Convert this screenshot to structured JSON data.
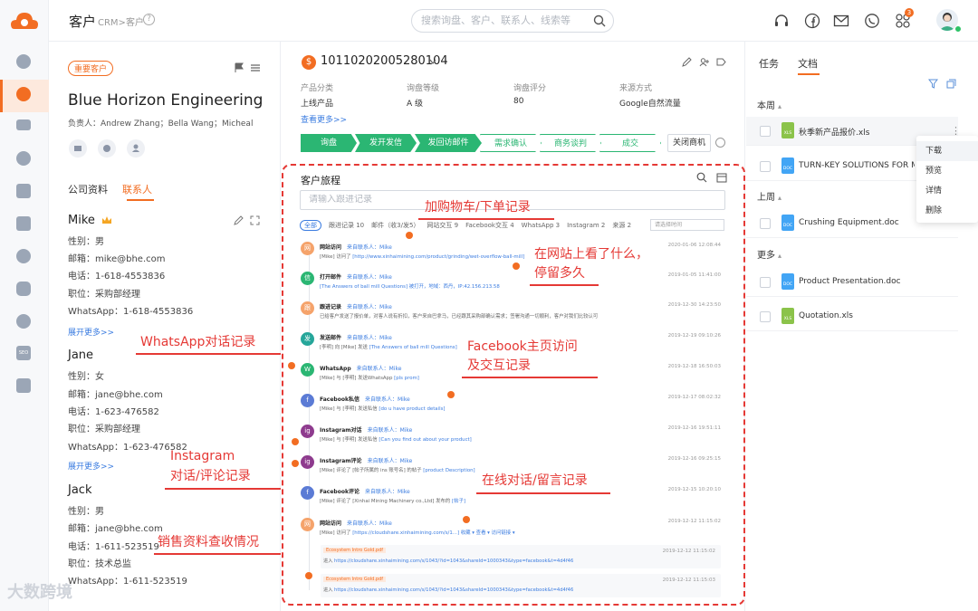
{
  "header": {
    "title": "客户",
    "crumb": "CRM>客户",
    "help": "?",
    "search_placeholder": "搜索询盘、客户、联系人、线索等",
    "notif_count": "3"
  },
  "rail": {
    "icons": [
      "dashboard-icon",
      "customer-icon",
      "mail-icon",
      "whatsapp-icon",
      "document-icon",
      "chat-icon",
      "facebook-icon",
      "instagram-icon",
      "google-icon",
      "seo-icon",
      "analytics-icon"
    ],
    "seo_label": "SEO"
  },
  "customer": {
    "tag": "重要客户",
    "name": "Blue Horizon Engineering",
    "owners": "负责人：Andrew Zhang；Bella Wang；Micheal",
    "tabs": [
      "公司资料",
      "联系人"
    ]
  },
  "contacts": [
    {
      "name": "Mike",
      "gender": "性别：男",
      "email": "邮箱：mike@bhe.com",
      "phone": "电话：1-618-4553836",
      "title": "职位：采购部经理",
      "whatsapp": "WhatsApp：1-618-4553836",
      "more": "展开更多>>"
    },
    {
      "name": "Jane",
      "gender": "性别：女",
      "email": "邮箱：jane@bhe.com",
      "phone": "电话：1-623-476582",
      "title": "职位：采购部经理",
      "whatsapp": "WhatsApp：1-623-476582",
      "more": "展开更多>>"
    },
    {
      "name": "Jack",
      "gender": "性别：男",
      "email": "邮箱：jane@bhe.com",
      "phone": "电话：1-611-523519",
      "title": "职位：技术总监",
      "whatsapp": "WhatsApp：1-611-523519"
    }
  ],
  "opportunity": {
    "currency_icon": "$",
    "number": "10110202005280104",
    "fields": [
      {
        "label": "产品分类",
        "value": "上线产品"
      },
      {
        "label": "询盘等级",
        "value": "A 级"
      },
      {
        "label": "询盘评分",
        "value": "80"
      },
      {
        "label": "来源方式",
        "value": "Google自然流量"
      }
    ],
    "see_more": "查看更多>>",
    "stages": [
      "询盘",
      "发开发信",
      "发回访邮件",
      "需求确认",
      "商务谈判",
      "成交"
    ],
    "stages_done": 3,
    "close_button": "关闭商机"
  },
  "journey": {
    "title": "客户旅程",
    "input_placeholder": "请输入跟进记录",
    "filters": {
      "all": "全部",
      "items": [
        "跟进记录 10",
        "邮件（收3/发5）",
        "网站交互 9",
        "Facebook交互 4",
        "WhatsApp 3",
        "Instagram 2",
        "来源 2"
      ]
    },
    "time_placeholder": "请选择时间",
    "events": [
      {
        "icon": "网",
        "color": "#f5a36b",
        "title": "网站访问",
        "source": "来自联系人：Mike",
        "desc": "[Mike] 访问了 ",
        "link": "[http://www.xinhaimining.com/product/grinding/wet-overflow-ball-mill]",
        "time": "2020-01-06 12:08:44"
      },
      {
        "icon": "信",
        "color": "#2bb673",
        "title": "打开邮件",
        "source": "来自联系人：Mike",
        "desc": "",
        "link": "[The Answers of ball mill Questions] 被打开，地域：西丹，IP:42.156.213.58",
        "time": "2019-01-05 11:41:00"
      },
      {
        "icon": "跟",
        "color": "#f5a36b",
        "title": "跟进记录",
        "source": "来自联系人：Mike",
        "desc": "已给客户发送了报价单，对客人说有折扣，客户来自巴拿马，已经跟其采购部确认需求；签署沟通一切顺利，客户对我们比较认可",
        "link": "",
        "time": "2019-12-30 14:23:50"
      },
      {
        "icon": "发",
        "color": "#26a69a",
        "title": "发送邮件",
        "source": "来自联系人：Mike",
        "desc": "[李明] 向 [Mike] 发送 ",
        "link": "[The Answers of ball mill Questions]",
        "time": "2019-12-19 09:10:26"
      },
      {
        "icon": "W",
        "color": "#2bb673",
        "title": "WhatsApp",
        "source": "来自联系人：Mike",
        "desc": "[Mike] 与 [李明] 发送WhatsApp ",
        "link": "[pls prom]",
        "time": "2019-12-18 16:50:03"
      },
      {
        "icon": "f",
        "color": "#5b7bd5",
        "title": "Facebook私信",
        "source": "来自联系人：Mike",
        "desc": "[Mike] 与 [李明] 发送私信 ",
        "link": "[do u have product details]",
        "time": "2019-12-17 08:02:32"
      },
      {
        "icon": "ig",
        "color": "#8e3b8e",
        "title": "Instagram对话",
        "source": "来自联系人：Mike",
        "desc": "[Mike] 与 [李明] 发送私信 ",
        "link": "[Can you find out about your product]",
        "time": "2019-12-16 19:51:11"
      },
      {
        "icon": "ig",
        "color": "#8e3b8e",
        "title": "Instagram评论",
        "source": "来自联系人：Mike",
        "desc": "[Mike] 评论了 [帖子所属的 ins 账号名] 的帖子 ",
        "link": "[product Description]",
        "time": "2019-12-16 09:25:15"
      },
      {
        "icon": "f",
        "color": "#5b7bd5",
        "title": "Facebook评论",
        "source": "来自联系人：Mike",
        "desc": "[Mike] 评论了 [Xinhai Mining Machinery co.,Ltd] 发布的 ",
        "link": "[帖子]",
        "time": "2019-12-15 10:20:10"
      },
      {
        "icon": "网",
        "color": "#f5a36b",
        "title": "网站访问",
        "source": "来自联系人：Mike",
        "desc": "[Mike] 访问了 ",
        "link": "[https://cloudshare.xinhaimining.com/s/1...]   收藏 ▾   查看 ▾   访问链接 ▾",
        "time": "2019-12-12 11:15:02"
      }
    ],
    "subevents": [
      {
        "tag": "Ecosystem Intro Gold.pdf",
        "line": "进入  ",
        "link": "https://cloudshare.xinhaimining.com/s/1043/?id=1043&shareId=1000343&type=facebook&t=4d4f46",
        "time": "2019-12-12 11:15:02"
      },
      {
        "tag": "Ecosystem Intro Gold.pdf",
        "line": "进入  ",
        "link": "https://cloudshare.xinhaimining.com/s/1043/?id=1043&shareId=1000343&type=facebook&t=4d4f46",
        "time": "2019-12-12 11:15:03"
      }
    ]
  },
  "annotations": [
    "加购物车/下单记录",
    "在网站上看了什么，",
    "停留多久",
    "WhatsApp对话记录",
    "Facebook主页访问",
    "及交互记录",
    "Instagram",
    "对话/评论记录",
    "在线对话/留言记录",
    "销售资料查收情况"
  ],
  "right": {
    "tabs": [
      "任务",
      "文档"
    ],
    "groups": [
      {
        "label": "本周",
        "files": [
          {
            "name": "秋季新产品报价.xls",
            "type": "xls"
          },
          {
            "name": "TURN-KEY SOLUTIONS FOR MINING",
            "type": "doc"
          }
        ]
      },
      {
        "label": "上周",
        "files": [
          {
            "name": "Crushing Equipment.doc",
            "type": "doc"
          }
        ]
      },
      {
        "label": "更多",
        "files": [
          {
            "name": "Product Presentation.doc",
            "type": "doc"
          },
          {
            "name": "Quotation.xls",
            "type": "xls"
          }
        ]
      }
    ],
    "file_type_labels": {
      "xls": "XLS",
      "doc": "DOC"
    },
    "context_menu": [
      "下载",
      "预览",
      "详情",
      "删除"
    ]
  },
  "watermark": "大数跨境"
}
